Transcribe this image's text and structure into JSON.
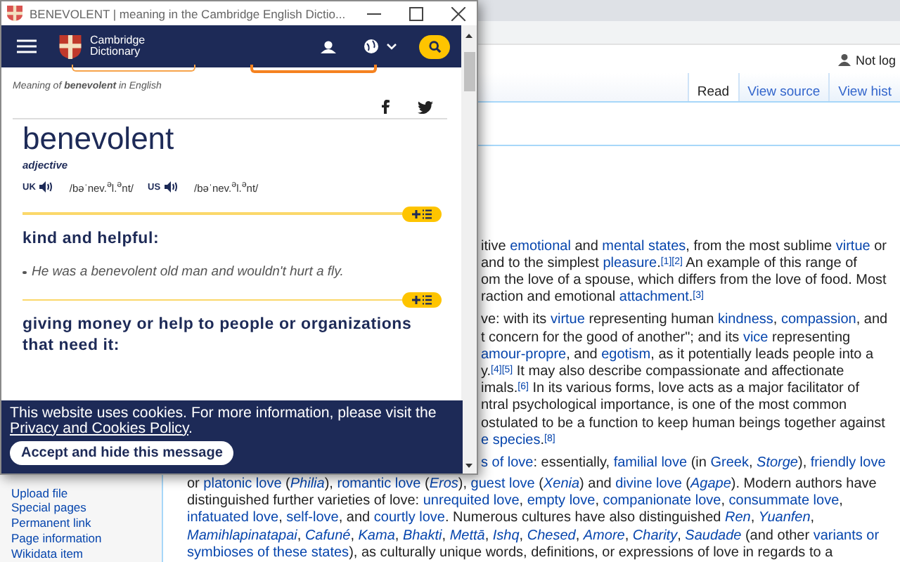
{
  "wiki": {
    "user_status": "Not log",
    "tabs": [
      {
        "label": "Read",
        "selected": true
      },
      {
        "label": "View source",
        "selected": false
      },
      {
        "label": "View hist",
        "selected": false
      }
    ],
    "fragment_paragraphs": [
      [
        [
          {
            "kind": "text",
            "t": "itive "
          },
          {
            "kind": "link",
            "t": "emotional"
          },
          {
            "kind": "text",
            "t": " and "
          },
          {
            "kind": "link",
            "t": "mental states"
          },
          {
            "kind": "text",
            "t": ", from the most sublime "
          },
          {
            "kind": "link",
            "t": "virtue"
          },
          {
            "kind": "text",
            "t": " or"
          }
        ],
        [
          {
            "kind": "text",
            "t": " and to the simplest "
          },
          {
            "kind": "link",
            "t": "pleasure"
          },
          {
            "kind": "ref",
            "lead": ".",
            "t": "[1][2]"
          },
          {
            "kind": "text",
            "t": " An example of this range of"
          }
        ],
        [
          {
            "kind": "text",
            "t": "om the love of a spouse, which differs from the love of food. Most"
          }
        ],
        [
          {
            "kind": "text",
            "t": "raction and emotional "
          },
          {
            "kind": "link",
            "t": "attachment"
          },
          {
            "kind": "ref",
            "lead": ".",
            "t": "[3]"
          }
        ]
      ],
      [
        [
          {
            "kind": "text",
            "t": "ve: with its "
          },
          {
            "kind": "link",
            "t": "virtue"
          },
          {
            "kind": "text",
            "t": " representing human "
          },
          {
            "kind": "link",
            "t": "kindness"
          },
          {
            "kind": "text",
            "t": ", "
          },
          {
            "kind": "link",
            "t": "compassion"
          },
          {
            "kind": "text",
            "t": ", and"
          }
        ],
        [
          {
            "kind": "text",
            "t": "t concern for the good of another\"; and its "
          },
          {
            "kind": "link",
            "t": "vice"
          },
          {
            "kind": "text",
            "t": " representing"
          }
        ],
        [
          {
            "kind": "link",
            "t": "amour-propre"
          },
          {
            "kind": "text",
            "t": ", and "
          },
          {
            "kind": "link",
            "t": "egotism"
          },
          {
            "kind": "text",
            "t": ", as it potentially leads people into a"
          }
        ],
        [
          {
            "kind": "text",
            "t": "y."
          },
          {
            "kind": "ref",
            "t": "[4][5]"
          },
          {
            "kind": "text",
            "t": " It may also describe compassionate and affectionate"
          }
        ],
        [
          {
            "kind": "text",
            "t": "imals."
          },
          {
            "kind": "ref",
            "t": "[6]"
          },
          {
            "kind": "text",
            "t": " In its various forms, love acts as a major facilitator of"
          }
        ],
        [
          {
            "kind": "text",
            "t": "ntral psychological importance, is one of the most common"
          }
        ],
        [
          {
            "kind": "text",
            "t": "ostulated to be a function to keep human beings together against"
          }
        ],
        [
          {
            "kind": "link",
            "t": "e species"
          },
          {
            "kind": "text",
            "t": "."
          },
          {
            "kind": "ref",
            "t": "[8]"
          }
        ]
      ],
      [
        [
          {
            "kind": "link",
            "t": "s of love"
          },
          {
            "kind": "text",
            "t": ": essentially, "
          },
          {
            "kind": "link",
            "t": "familial love"
          },
          {
            "kind": "text",
            "t": " (in "
          },
          {
            "kind": "link",
            "t": "Greek"
          },
          {
            "kind": "text",
            "t": ", "
          },
          {
            "kind": "link",
            "t": "*Storge*"
          },
          {
            "kind": "text",
            "t": "), "
          },
          {
            "kind": "link",
            "t": "friendly love"
          }
        ]
      ]
    ],
    "full_lines": [
      [
        {
          "kind": "text",
          "t": "or "
        },
        {
          "kind": "link",
          "t": "platonic love"
        },
        {
          "kind": "text",
          "t": " ("
        },
        {
          "kind": "link",
          "t": "*Philia*"
        },
        {
          "kind": "text",
          "t": "), "
        },
        {
          "kind": "link",
          "t": "romantic love"
        },
        {
          "kind": "text",
          "t": " ("
        },
        {
          "kind": "link",
          "t": "*Eros*"
        },
        {
          "kind": "text",
          "t": "), "
        },
        {
          "kind": "link",
          "t": "guest love"
        },
        {
          "kind": "text",
          "t": " ("
        },
        {
          "kind": "link",
          "t": "*Xenia*"
        },
        {
          "kind": "text",
          "t": ") and "
        },
        {
          "kind": "link",
          "t": "divine love"
        },
        {
          "kind": "text",
          "t": " ("
        },
        {
          "kind": "link",
          "t": "*Agape*"
        },
        {
          "kind": "text",
          "t": "). Modern authors have"
        }
      ],
      [
        {
          "kind": "text",
          "t": "distinguished further varieties of love: "
        },
        {
          "kind": "link",
          "t": "unrequited love"
        },
        {
          "kind": "text",
          "t": ", "
        },
        {
          "kind": "link",
          "t": "empty love"
        },
        {
          "kind": "text",
          "t": ", "
        },
        {
          "kind": "link",
          "t": "companionate love"
        },
        {
          "kind": "text",
          "t": ", "
        },
        {
          "kind": "link",
          "t": "consummate love"
        },
        {
          "kind": "text",
          "t": ","
        }
      ],
      [
        {
          "kind": "link",
          "t": "infatuated love"
        },
        {
          "kind": "text",
          "t": ", "
        },
        {
          "kind": "link",
          "t": "self-love"
        },
        {
          "kind": "text",
          "t": ", and "
        },
        {
          "kind": "link",
          "t": "courtly love"
        },
        {
          "kind": "text",
          "t": ". Numerous cultures have also distinguished "
        },
        {
          "kind": "link",
          "t": "*Ren*"
        },
        {
          "kind": "text",
          "t": ", "
        },
        {
          "kind": "link",
          "t": "*Yuanfen*"
        },
        {
          "kind": "text",
          "t": ","
        }
      ],
      [
        {
          "kind": "link",
          "t": "*Mamihlapinatapai*"
        },
        {
          "kind": "text",
          "t": ", "
        },
        {
          "kind": "link",
          "t": "*Cafuné*"
        },
        {
          "kind": "text",
          "t": ", "
        },
        {
          "kind": "link",
          "t": "*Kama*"
        },
        {
          "kind": "text",
          "t": ", "
        },
        {
          "kind": "link",
          "t": "*Bhakti*"
        },
        {
          "kind": "text",
          "t": ", "
        },
        {
          "kind": "link",
          "t": "*Mettā*"
        },
        {
          "kind": "text",
          "t": ", "
        },
        {
          "kind": "link",
          "t": "*Ishq*"
        },
        {
          "kind": "text",
          "t": ", "
        },
        {
          "kind": "link",
          "t": "*Chesed*"
        },
        {
          "kind": "text",
          "t": ", "
        },
        {
          "kind": "link",
          "t": "*Amore*"
        },
        {
          "kind": "text",
          "t": ", "
        },
        {
          "kind": "link",
          "t": "*Charity*"
        },
        {
          "kind": "text",
          "t": ", "
        },
        {
          "kind": "link",
          "t": "*Saudade*"
        },
        {
          "kind": "text",
          "t": " (and other "
        },
        {
          "kind": "link",
          "t": "variants or"
        }
      ],
      [
        {
          "kind": "link",
          "t": "symbioses of these states"
        },
        {
          "kind": "text",
          "t": "), as culturally unique words, definitions, or expressions of love in regards to a"
        }
      ]
    ],
    "sidebar_links": [
      "Upload file",
      "Special pages",
      "Permanent link",
      "Page information",
      "Wikidata item"
    ]
  },
  "popup": {
    "title": "BENEVOLENT | meaning in the Cambridge English Dictio...",
    "logo_text": [
      "Cambridge",
      "Dictionary"
    ],
    "meaning_line": "Meaning of **benevolent** in English",
    "headword": "benevolent",
    "part_of_speech": "adjective",
    "pronunciations": [
      {
        "region": "UK",
        "ipa": "/bəˈnev.$^{ə}$l.$^{ə}$nt/"
      },
      {
        "region": "US",
        "ipa": "/bəˈnev.$^{ə}$l.$^{ə}$nt/"
      }
    ],
    "senses": [
      {
        "definition": "kind and helpful:",
        "examples": [
          "He was a benevolent old man and wouldn't hurt a fly."
        ]
      },
      {
        "definition": "giving money or help to people or organizations that need it:"
      }
    ],
    "cookie": {
      "text": "This website uses cookies. For more information, please visit the",
      "link": "Privacy and Cookies Policy",
      "after": ".",
      "button": "Accept and hide this message"
    }
  }
}
